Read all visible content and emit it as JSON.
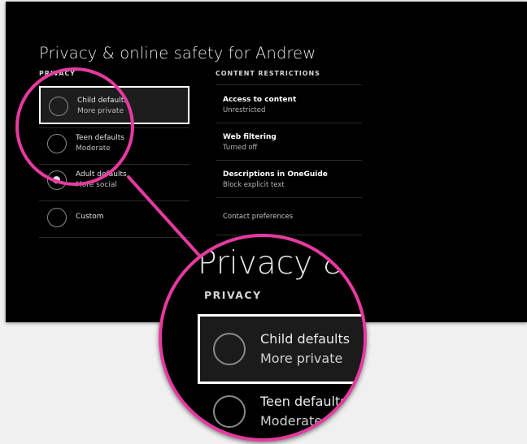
{
  "title": "Privacy & online safety for Andrew",
  "privacy": {
    "heading": "PRIVACY",
    "options": [
      {
        "label": "Child defaults",
        "sublabel": "More private",
        "selected": false,
        "focused": true
      },
      {
        "label": "Teen defaults",
        "sublabel": "Moderate",
        "selected": false,
        "focused": false
      },
      {
        "label": "Adult defaults",
        "sublabel": "More social",
        "selected": true,
        "focused": false
      },
      {
        "label": "Custom",
        "sublabel": "",
        "selected": false,
        "focused": false
      }
    ]
  },
  "content_restrictions": {
    "heading": "CONTENT RESTRICTIONS",
    "items": [
      {
        "title": "Access to content",
        "value": "Unrestricted"
      },
      {
        "title": "Web filtering",
        "value": "Turned off"
      },
      {
        "title": "Descriptions in OneGuide",
        "value": "Block explicit text"
      }
    ],
    "contact_preferences": "Contact preferences"
  },
  "magnifier": {
    "title": "Privacy & o",
    "heading": "PRIVACY",
    "child_label": "Child defaults",
    "child_sublabel": "More private",
    "teen_label": "Teen defaults",
    "teen_sublabel": "Moderate"
  },
  "colors": {
    "highlight_ring": "#e63aa0",
    "background": "#000000",
    "page": "#f0f0f0"
  }
}
